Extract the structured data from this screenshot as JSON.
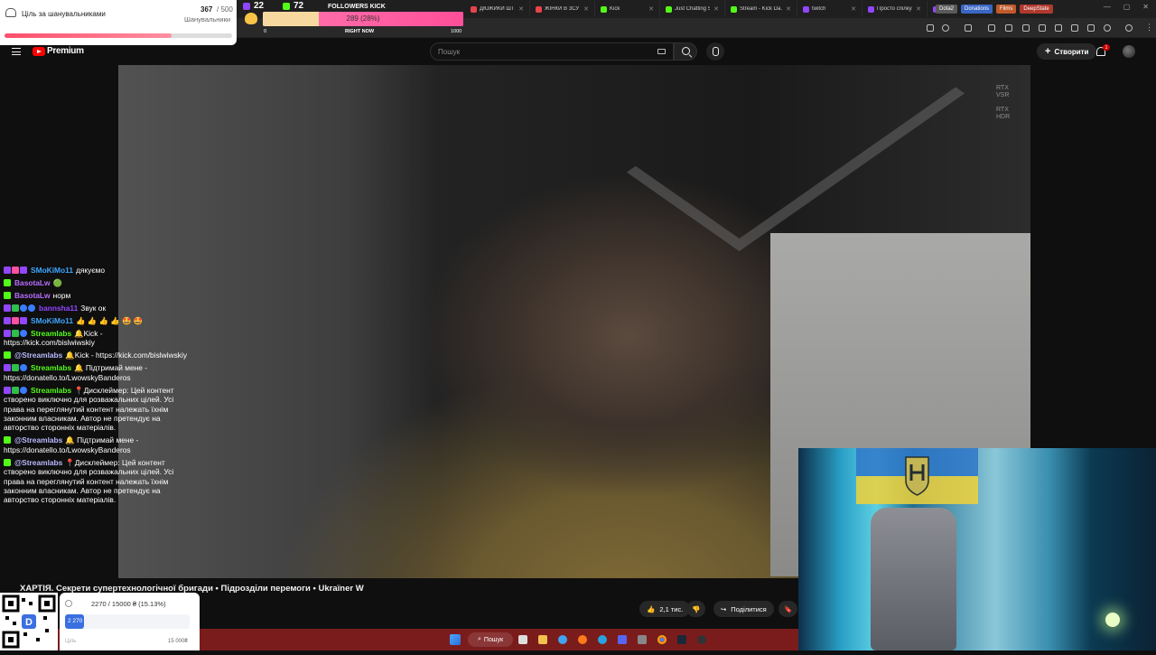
{
  "browser": {
    "tabs": [
      {
        "label": "ДЮЖИКИ ШТУР...",
        "color": "#e8434a"
      },
      {
        "label": "ЖІНКИ В ЗСУ / Б...",
        "color": "#e8434a"
      },
      {
        "label": "Kick",
        "color": "#53fc18"
      },
      {
        "label": "Just Chatting Str...",
        "color": "#53fc18"
      },
      {
        "label": "Stream - Kick Da...",
        "color": "#53fc18"
      },
      {
        "label": "twitch",
        "color": "#9146ff"
      },
      {
        "label": "Просто спілкую...",
        "color": "#9146ff"
      },
      {
        "label": "Twitch",
        "color": "#9146ff"
      }
    ],
    "bookmarks": [
      {
        "label": "Dota2",
        "color": "#5a5a5a"
      },
      {
        "label": "Donations",
        "color": "#3a66c4"
      },
      {
        "label": "Films",
        "color": "#c05a2b"
      },
      {
        "label": "DeepState",
        "color": "#b0392e"
      }
    ]
  },
  "youtube": {
    "logo_text": "Premium",
    "search_placeholder": "Пошук",
    "create_label": "Створити",
    "notif_count": "1"
  },
  "video": {
    "rtx_labels": [
      "RTX",
      "VSR",
      "RTX",
      "HDR"
    ],
    "title": "ХАРТІЯ. Секрети супертехнологічної бригади • Підрозділи перемоги • Ukraїner W",
    "likes": "2,1 тис.",
    "share_label": "Поділитися"
  },
  "supporters_widget": {
    "label": "Ціль за шанувальниками",
    "count": "367",
    "total": "/ 500",
    "sublabel": "Шанувальники",
    "progress": 0.734
  },
  "followers_widget": {
    "count_twitch": "22",
    "count_kick": "72",
    "title": "FOLLOWERS KICK",
    "bar_text": "289 (28%)",
    "progress": 0.28,
    "right_now": "RIGHT NOW",
    "min": "0",
    "max": "1000"
  },
  "chat": {
    "messages": [
      {
        "user": "SMoKiMo11",
        "user_color": "#3ea6ff",
        "badges": [
          "tw",
          "heart",
          "tw"
        ],
        "text": "дякуємо"
      },
      {
        "user": "BasotaLw",
        "user_color": "#b96cff",
        "badges": [
          "kick"
        ],
        "text": "🟢"
      },
      {
        "user": "BasotaLw",
        "user_color": "#b96cff",
        "badges": [
          "kick"
        ],
        "text": "норм"
      },
      {
        "user": "bannsha11",
        "user_color": "#9146ff",
        "badges": [
          "tw",
          "green",
          "blue",
          "blue"
        ],
        "text": "Звук ок"
      },
      {
        "user": "SMoKiMo11",
        "user_color": "#3ea6ff",
        "badges": [
          "tw",
          "heart",
          "tw"
        ],
        "text": "👍 👍 👍 👍 🤩 🤩"
      },
      {
        "user": "Streamlabs",
        "user_color": "#53fc18",
        "badges": [
          "tw",
          "green",
          "blue"
        ],
        "text": "🔔Kick - https://kick.com/bislwiwskiy"
      },
      {
        "user": "@Streamlabs",
        "user_color": "#b9b9ff",
        "badges": [
          "kick"
        ],
        "text": "🔔Kick - https://kick.com/bislwiwskiy"
      },
      {
        "user": "Streamlabs",
        "user_color": "#53fc18",
        "badges": [
          "tw",
          "green",
          "blue"
        ],
        "text": "🔔 Підтримай мене - https://donatello.to/LwowskyBanderos"
      },
      {
        "user": "Streamlabs",
        "user_color": "#53fc18",
        "badges": [
          "tw",
          "green",
          "blue"
        ],
        "text": "📍Дисклеймер: Цей контент створено виключно для розважальних цілей. Усі права на переглянутий контент належать їхнім законним власникам. Автор не претендує на авторство сторонніх матеріалів."
      },
      {
        "user": "@Streamlabs",
        "user_color": "#b9b9ff",
        "badges": [
          "kick"
        ],
        "text": "🔔 Підтримай мене - https://donatello.to/LwowskyBanderos"
      },
      {
        "user": "@Streamlabs",
        "user_color": "#b9b9ff",
        "badges": [
          "kick"
        ],
        "text": "📍Дисклеймер: Цей контент створено виключно для розважальних цілей. Усі права на переглянутий контент належать їхнім законним власникам. Автор не претендує на авторство сторонніх матеріалів."
      }
    ]
  },
  "donation_widget": {
    "summary": "2270 / 15000 ₴ (15.13%)",
    "current": "2 270",
    "goal_label": "Ціль",
    "goal_value": "15 000₴",
    "progress": 0.1513
  },
  "taskbar": {
    "search_label": "Пошук",
    "bg_color": "#7b1c1c"
  }
}
